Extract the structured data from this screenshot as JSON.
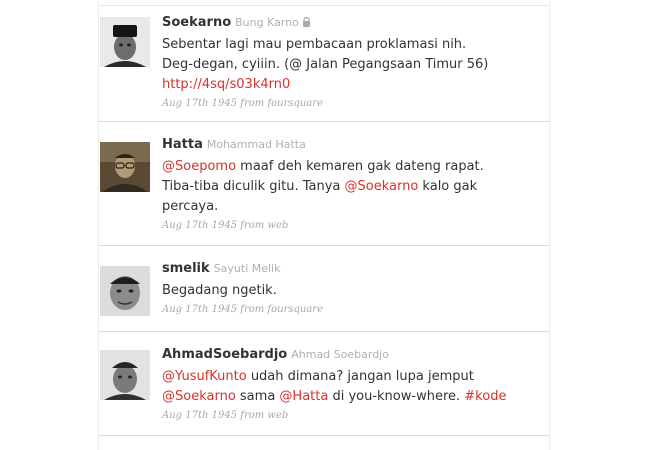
{
  "colors": {
    "link": "#d8322b",
    "text": "#333333",
    "muted": "#b0b0b0",
    "divider": "#dcdcdc"
  },
  "tweets": [
    {
      "screen_name": "Soekarno",
      "full_name": "Bung Karno",
      "protected_icon": "lock-icon",
      "text_1": "Sebentar lagi mau pembacaan proklamasi nih.",
      "text_2": "Deg-degan, cyiiin. (@ Jalan Pegangsaan Timur 56)",
      "url": "http://4sq/s03k4rn0",
      "time": "Aug 17th 1945",
      "from": "from",
      "source": "foursquare"
    },
    {
      "screen_name": "Hatta",
      "full_name": "Mohammad Hatta",
      "mention_1": "@Soepomo",
      "text_1": " maaf deh kemaren gak dateng rapat.",
      "text_2": "Tiba-tiba diculik gitu. Tanya ",
      "mention_2": "@Soekarno",
      "text_3": " kalo gak",
      "text_4": "percaya.",
      "time": "Aug 17th 1945",
      "from": "from",
      "source": "web"
    },
    {
      "screen_name": "smelik",
      "full_name": "Sayuti Melik",
      "text_1": "Begadang ngetik.",
      "time": "Aug 17th 1945",
      "from": "from",
      "source": "foursquare"
    },
    {
      "screen_name": "AhmadSoebardjo",
      "full_name": "Ahmad Soebardjo",
      "mention_1": "@YusufKunto",
      "text_1": " udah dimana? jangan lupa jemput",
      "mention_2": "@Soekarno",
      "text_2": " sama ",
      "mention_3": "@Hatta",
      "text_3": " di you-know-where. ",
      "hashtag": "#kode",
      "time": "Aug 17th 1945",
      "from": "from",
      "source": "web"
    }
  ]
}
